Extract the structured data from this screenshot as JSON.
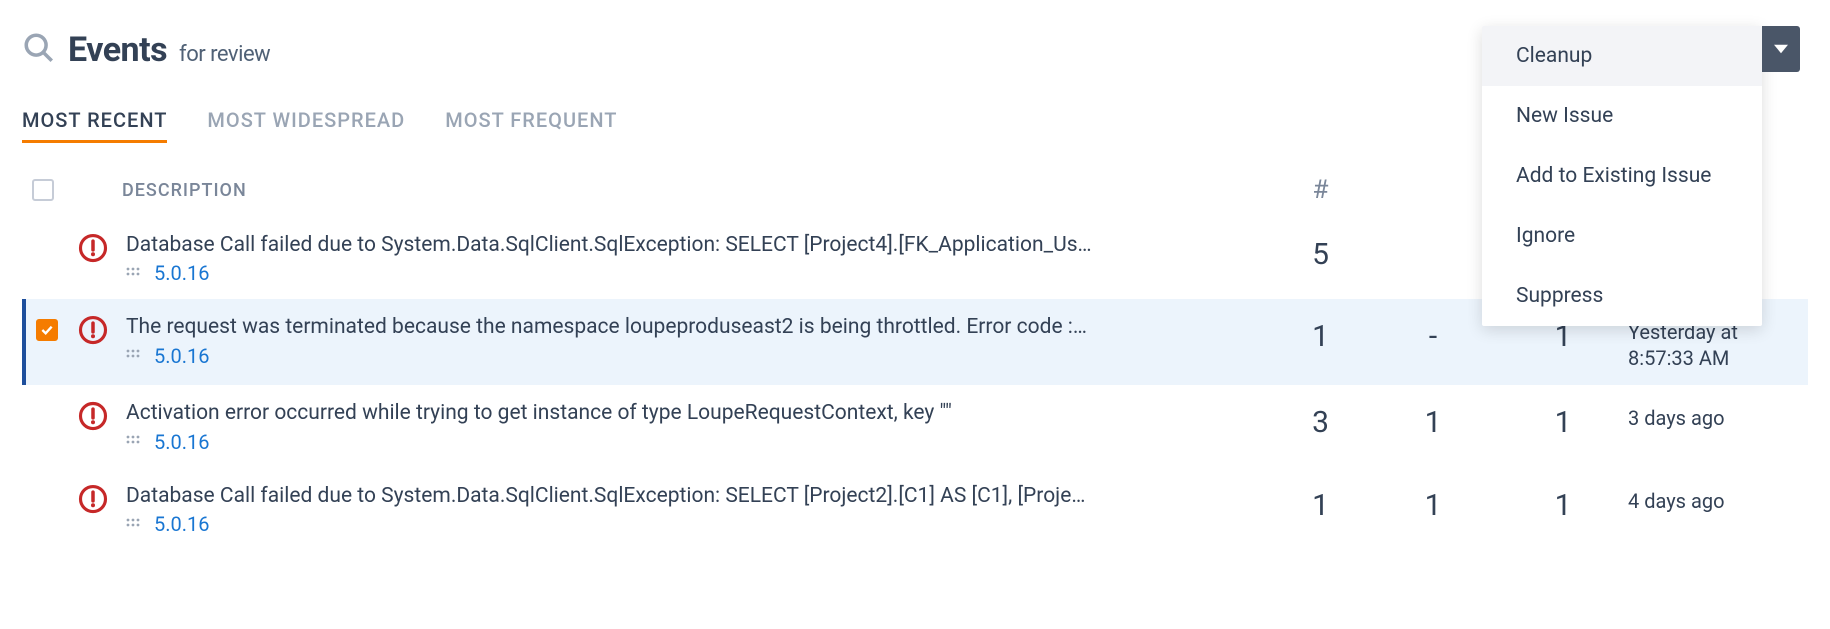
{
  "header": {
    "title": "Events",
    "subtitle": "for review"
  },
  "tabs": [
    {
      "label": "MOST RECENT",
      "active": true
    },
    {
      "label": "MOST WIDESPREAD",
      "active": false
    },
    {
      "label": "MOST FREQUENT",
      "active": false
    }
  ],
  "columns": {
    "description": "DESCRIPTION",
    "hash": "#"
  },
  "rows": [
    {
      "selected": false,
      "title": "Database Call failed due to System.Data.SqlClient.SqlException: SELECT [Project4].[FK_Application_Us…",
      "version": "5.0.16",
      "count": "5",
      "col2": "",
      "col3": "",
      "time": "",
      "time_hidden": true
    },
    {
      "selected": true,
      "title": "The request was terminated because the namespace loupeproduseast2 is being throttled. Error code :…",
      "version": "5.0.16",
      "count": "1",
      "col2": "-",
      "col3": "1",
      "time": "Yesterday at 8:57:33 AM"
    },
    {
      "selected": false,
      "title": "Activation error occurred while trying to get instance of type LoupeRequestContext, key \"\"",
      "version": "5.0.16",
      "count": "3",
      "col2": "1",
      "col3": "1",
      "time": "3 days ago"
    },
    {
      "selected": false,
      "title": "Database Call failed due to System.Data.SqlClient.SqlException: SELECT [Project2].[C1] AS [C1], [Proje…",
      "version": "5.0.16",
      "count": "1",
      "col2": "1",
      "col3": "1",
      "time": "4 days ago"
    }
  ],
  "dropdown": {
    "items": [
      {
        "label": "Cleanup",
        "highlight": true
      },
      {
        "label": "New Issue",
        "highlight": false
      },
      {
        "label": "Add to Existing Issue",
        "highlight": false
      },
      {
        "label": "Ignore",
        "highlight": false
      },
      {
        "label": "Suppress",
        "highlight": false
      }
    ]
  }
}
